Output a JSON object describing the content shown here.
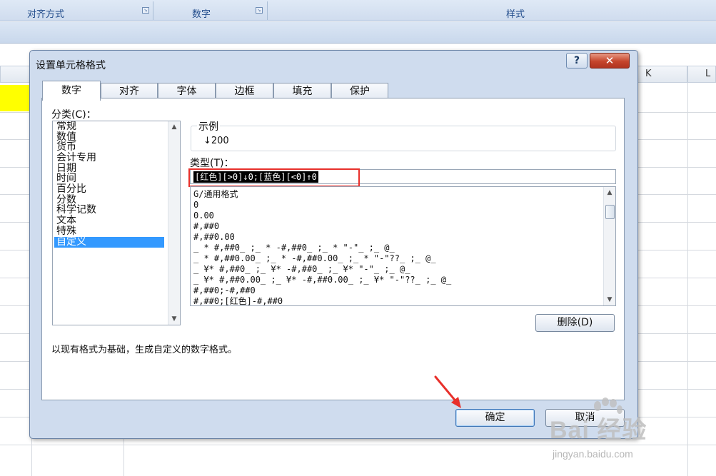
{
  "ribbon": {
    "groups": [
      {
        "label": "对齐方式",
        "launcher": "dialog-launcher-icon"
      },
      {
        "label": "数字",
        "launcher": "dialog-launcher-icon"
      },
      {
        "label": "样式"
      }
    ]
  },
  "sheet": {
    "column_headers": [
      "K",
      "L"
    ],
    "highlight_color": "#ffff00"
  },
  "dialog": {
    "title": "设置单元格格式",
    "help_label": "?",
    "close_label": "✕",
    "tabs": [
      "数字",
      "对齐",
      "字体",
      "边框",
      "填充",
      "保护"
    ],
    "active_tab": "数字",
    "category_label": "分类(C)：",
    "categories": [
      "常规",
      "数值",
      "货币",
      "会计专用",
      "日期",
      "时间",
      "百分比",
      "分数",
      "科学记数",
      "文本",
      "特殊",
      "自定义"
    ],
    "selected_category": "自定义",
    "sample_label": "示例",
    "sample_value": "↓200",
    "type_label": "类型(T)：",
    "type_value": "[红色][>0]↓0;[蓝色][<0]↑0",
    "format_list": [
      "G/通用格式",
      "0",
      "0.00",
      "#,##0",
      "#,##0.00",
      "_ * #,##0_ ;_ * -#,##0_ ;_ * \"-\"_ ;_ @_",
      "_ * #,##0.00_ ;_ * -#,##0.00_ ;_ * \"-\"??_ ;_ @_",
      "_ ¥* #,##0_ ;_ ¥* -#,##0_ ;_ ¥* \"-\"_ ;_ @_",
      "_ ¥* #,##0.00_ ;_ ¥* -#,##0.00_ ;_ ¥* \"-\"??_ ;_ @_",
      "#,##0;-#,##0",
      "#,##0;[红色]-#,##0"
    ],
    "delete_label": "删除(D)",
    "description": "以现有格式为基础，生成自定义的数字格式。",
    "ok_label": "确定",
    "cancel_label": "取消",
    "highlight_color": "#e8302b",
    "selection_color": "#3399ff"
  },
  "watermark": {
    "main": "Bai 经验",
    "sub": "jingyan.baidu.com"
  }
}
